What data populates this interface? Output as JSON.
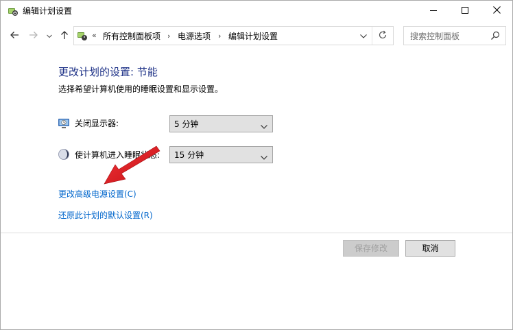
{
  "window": {
    "title": "编辑计划设置"
  },
  "nav": {
    "breadcrumb_overflow": "«",
    "breadcrumbs": [
      "所有控制面板项",
      "电源选项",
      "编辑计划设置"
    ],
    "search_placeholder": "搜索控制面板"
  },
  "main": {
    "title": "更改计划的设置: 节能",
    "subtitle": "选择希望计算机使用的睡眠设置和显示设置。",
    "display_off": {
      "label": "关闭显示器:",
      "value": "5 分钟"
    },
    "sleep": {
      "label": "使计算机进入睡眠状态:",
      "value": "15 分钟"
    },
    "links": {
      "advanced": "更改高级电源设置(C)",
      "restore": "还原此计划的默认设置(R)"
    }
  },
  "footer": {
    "save_label": "保存修改",
    "cancel_label": "取消"
  },
  "colors": {
    "title_blue": "#1e3287",
    "link_blue": "#0066cc",
    "annotation_arrow": "#e2161c"
  }
}
